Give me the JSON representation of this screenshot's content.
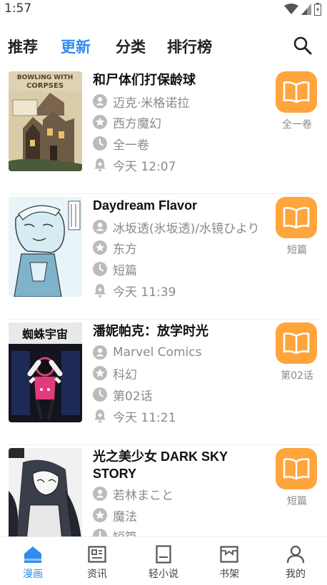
{
  "status": {
    "time": "1:57"
  },
  "tabs": [
    {
      "label": "推荐"
    },
    {
      "label": "更新"
    },
    {
      "label": "分类"
    },
    {
      "label": "排行榜"
    }
  ],
  "active_tab": "更新",
  "items": [
    {
      "title": "和尸体们打保龄球",
      "author": "迈克·米格诺拉",
      "genre": "西方魔幻",
      "chapter": "全一卷",
      "updated": "今天 12:07",
      "badge": "全一卷",
      "cover_text": "BOWLING WITH CORPSES"
    },
    {
      "title": "Daydream Flavor",
      "author": "冰坂透(氷坂透)/水镜ひより",
      "genre": "东方",
      "chapter": "短篇",
      "updated": "今天 11:39",
      "badge": "短篇"
    },
    {
      "title": "潘妮帕克：放学时光",
      "author": "Marvel Comics",
      "genre": "科幻",
      "chapter": "第02话",
      "updated": "今天 11:21",
      "badge": "第02话",
      "cover_text": "蜘蛛宇宙"
    },
    {
      "title": "光之美少女 DARK SKY STORY",
      "author": "若林まこと",
      "genre": "魔法",
      "chapter": "短篇",
      "updated": "",
      "badge": "短篇"
    }
  ],
  "bottom_nav": [
    {
      "label": "漫画",
      "icon": "home-icon"
    },
    {
      "label": "资讯",
      "icon": "news-icon"
    },
    {
      "label": "轻小说",
      "icon": "book-icon"
    },
    {
      "label": "书架",
      "icon": "shelf-icon"
    },
    {
      "label": "我的",
      "icon": "profile-icon"
    }
  ],
  "colors": {
    "accent": "#2f8cf0",
    "badge": "#ffa53b",
    "meta": "#8a8a8a"
  }
}
